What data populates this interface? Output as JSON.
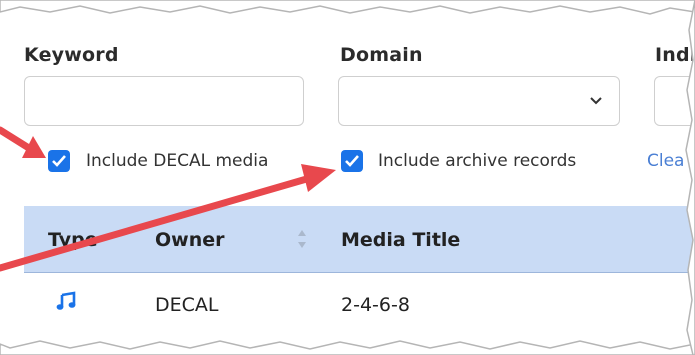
{
  "filters": {
    "keyword_label": "Keyword",
    "keyword_value": "",
    "domain_label": "Domain",
    "domain_value": "",
    "third_label": "Indi",
    "include_decal_label": "Include DECAL media",
    "include_decal_checked": true,
    "include_archive_label": "Include archive records",
    "include_archive_checked": true,
    "clear_label": "Clea"
  },
  "table": {
    "columns": [
      "Type",
      "Owner",
      "Media Title"
    ],
    "rows": [
      {
        "type_icon": "music-note-icon",
        "owner": "DECAL",
        "title": "2-4-6-8"
      }
    ]
  },
  "colors": {
    "accent": "#1a73e8",
    "header_bg": "#c9dbf5",
    "arrow": "#e8484d",
    "link": "#4a7fd4"
  }
}
